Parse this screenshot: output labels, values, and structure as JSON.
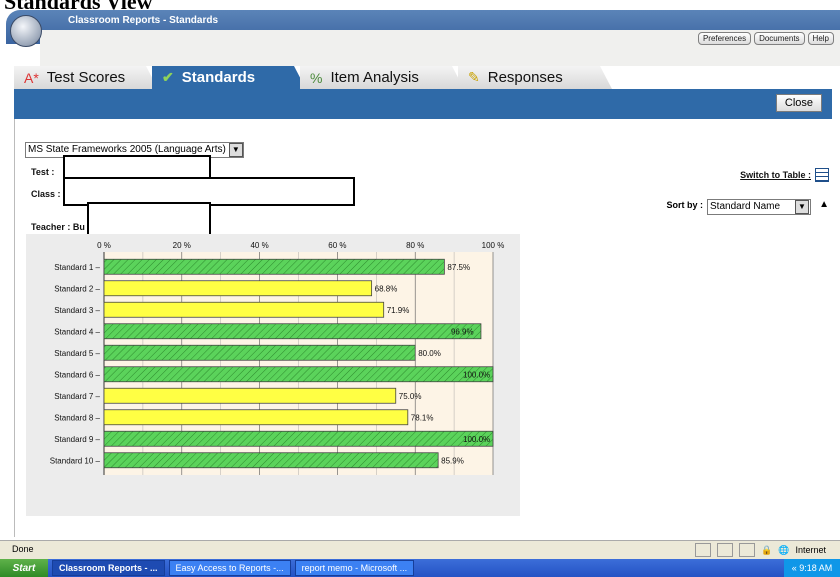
{
  "page": {
    "heading": "Standards View"
  },
  "app": {
    "title": "Classroom Reports - Standards",
    "links": [
      "Preferences",
      "Documents",
      "Help"
    ]
  },
  "tabs": [
    {
      "label": "Test Scores",
      "icon": "grade-icon"
    },
    {
      "label": "Standards",
      "icon": "checkmark-icon",
      "active": true
    },
    {
      "label": "Item Analysis",
      "icon": "percent-icon"
    },
    {
      "label": "Responses",
      "icon": "pencil-icon"
    }
  ],
  "toolbar": {
    "close_label": "Close"
  },
  "filters": {
    "framework": "MS State Frameworks 2005 (Language Arts)",
    "test_label": "Test",
    "class_label": "Class",
    "teacher_label": "Teacher : Bu",
    "switch_label": "Switch to Table :",
    "sort_label": "Sort by :",
    "sort_value": "Standard Name"
  },
  "chart_data": {
    "type": "bar",
    "orientation": "horizontal",
    "categories": [
      "Standard 1",
      "Standard 2",
      "Standard 3",
      "Standard 4",
      "Standard 5",
      "Standard 6",
      "Standard 7",
      "Standard 8",
      "Standard 9",
      "Standard 10"
    ],
    "values": [
      87.5,
      68.8,
      71.9,
      96.9,
      80.0,
      100.0,
      75.0,
      78.1,
      100.0,
      85.9
    ],
    "value_labels": [
      "87.5%",
      "68.8%",
      "71.9%",
      "96.9%",
      "80.0%",
      "100.0%",
      "75.0%",
      "78.1%",
      "100.0%",
      "85.9%"
    ],
    "bar_colors": [
      "#5bd35b",
      "#ffff44",
      "#ffff44",
      "#5bd35b",
      "#5bd35b",
      "#5bd35b",
      "#ffff44",
      "#ffff44",
      "#5bd35b",
      "#5bd35b"
    ],
    "xticks": [
      "0 %",
      "20 %",
      "40 %",
      "60 %",
      "80 %",
      "100 %"
    ],
    "xlim": [
      0,
      100
    ],
    "grid": true
  },
  "status": {
    "left": "Done",
    "zone": "Internet"
  },
  "taskbar": {
    "start": "Start",
    "items": [
      "Classroom Reports - ...",
      "Easy Access to Reports -...",
      "report memo - Microsoft ..."
    ],
    "time": "« 9:18 AM"
  }
}
